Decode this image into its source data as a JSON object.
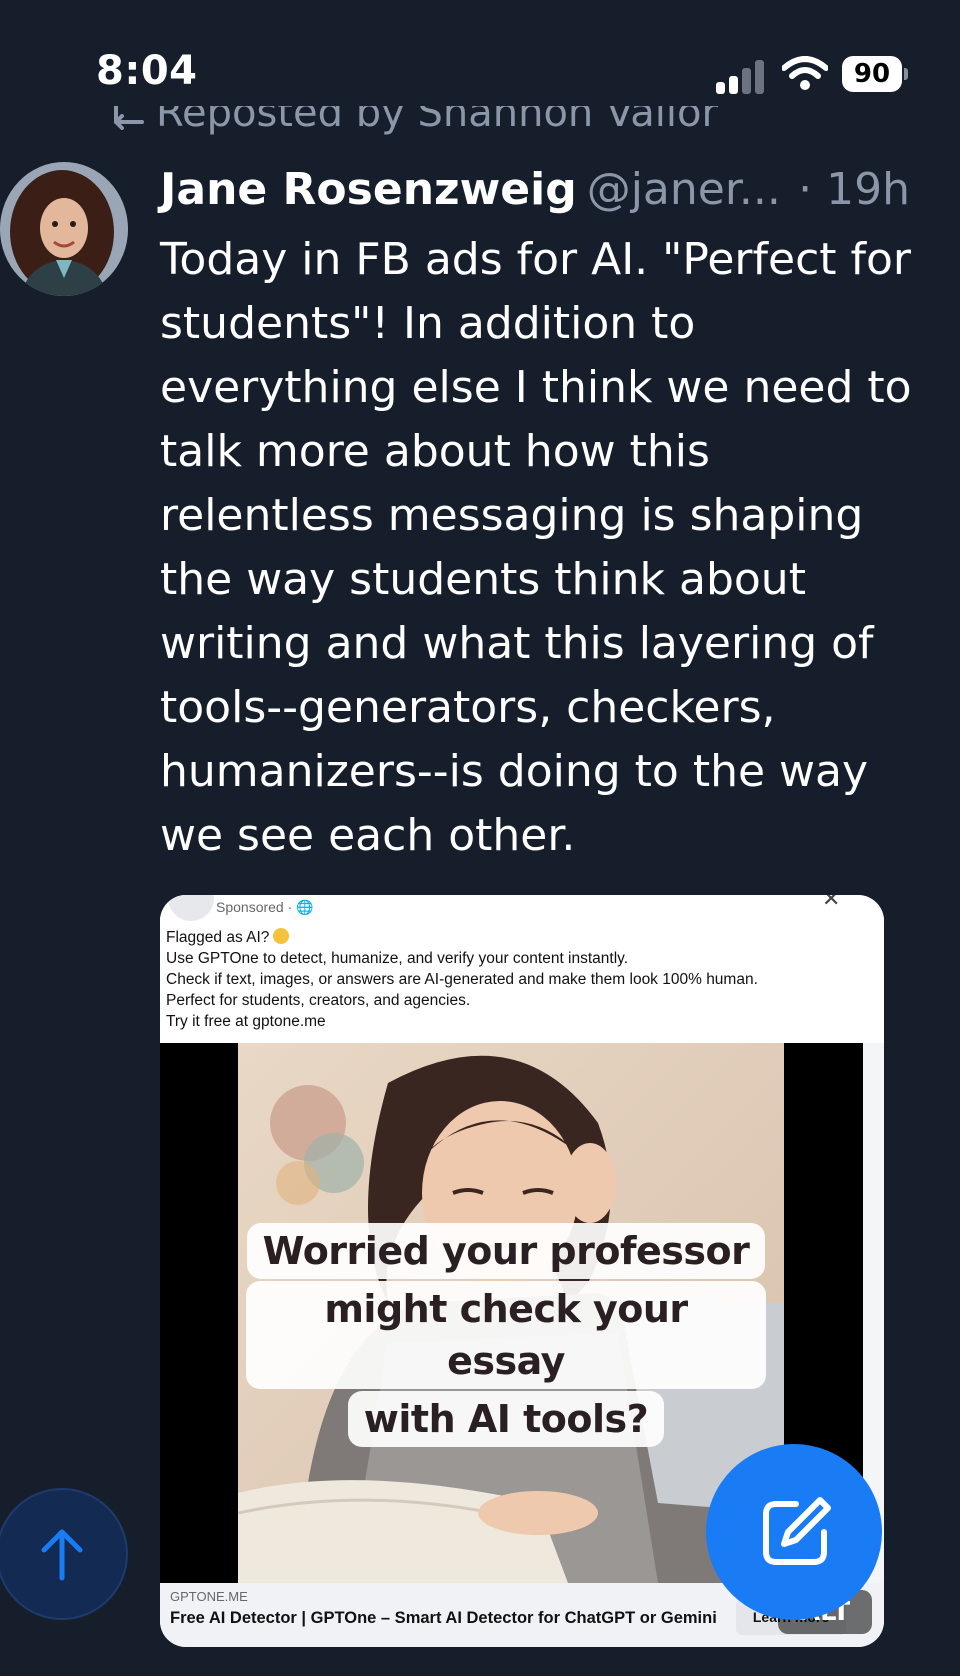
{
  "status_bar": {
    "time": "8:04",
    "battery": "90"
  },
  "repost": {
    "text": "Reposted by Shannon Vallor"
  },
  "post": {
    "author_name": "Jane Rosenzweig",
    "author_handle": "@janer...",
    "time": "· 19h",
    "text": "Today in FB ads for AI. \"Perfect for students\"! In addition to everything else I think we need to talk more about how this relentless messaging is shaping the way students think about writing and what this layering of tools--generators, checkers, humanizers--is doing to the way we see each other."
  },
  "ad": {
    "sponsored": "Sponsored · ",
    "more": "···",
    "close": "✕",
    "line1": "Flagged as AI?",
    "line2": "Use GPTOne to detect, humanize, and verify your content instantly.",
    "line3": "Check if text, images, or answers are AI-generated and make them look 100% human.",
    "line4": "Perfect for students, creators, and agencies.",
    "line5": "Try it free at gptone.me",
    "overlay_line1": "Worried your professor",
    "overlay_line2": "might check your essay",
    "overlay_line3": "with AI tools?",
    "domain": "GPTONE.ME",
    "headline": "Free AI Detector | GPTOne – Smart AI Detector for ChatGPT or Gemini",
    "cta": "Learn more"
  },
  "alt_badge": "ALT",
  "icons": {
    "signal": "cellular-signal-icon",
    "wifi": "wifi-icon",
    "repost": "repost-icon",
    "scroll_top": "arrow-up-icon",
    "compose": "compose-icon"
  },
  "colors": {
    "background": "#161e2b",
    "text_secondary": "#8b96a8",
    "compose_button": "#1a7cf5",
    "scroll_button": "#132a52"
  }
}
